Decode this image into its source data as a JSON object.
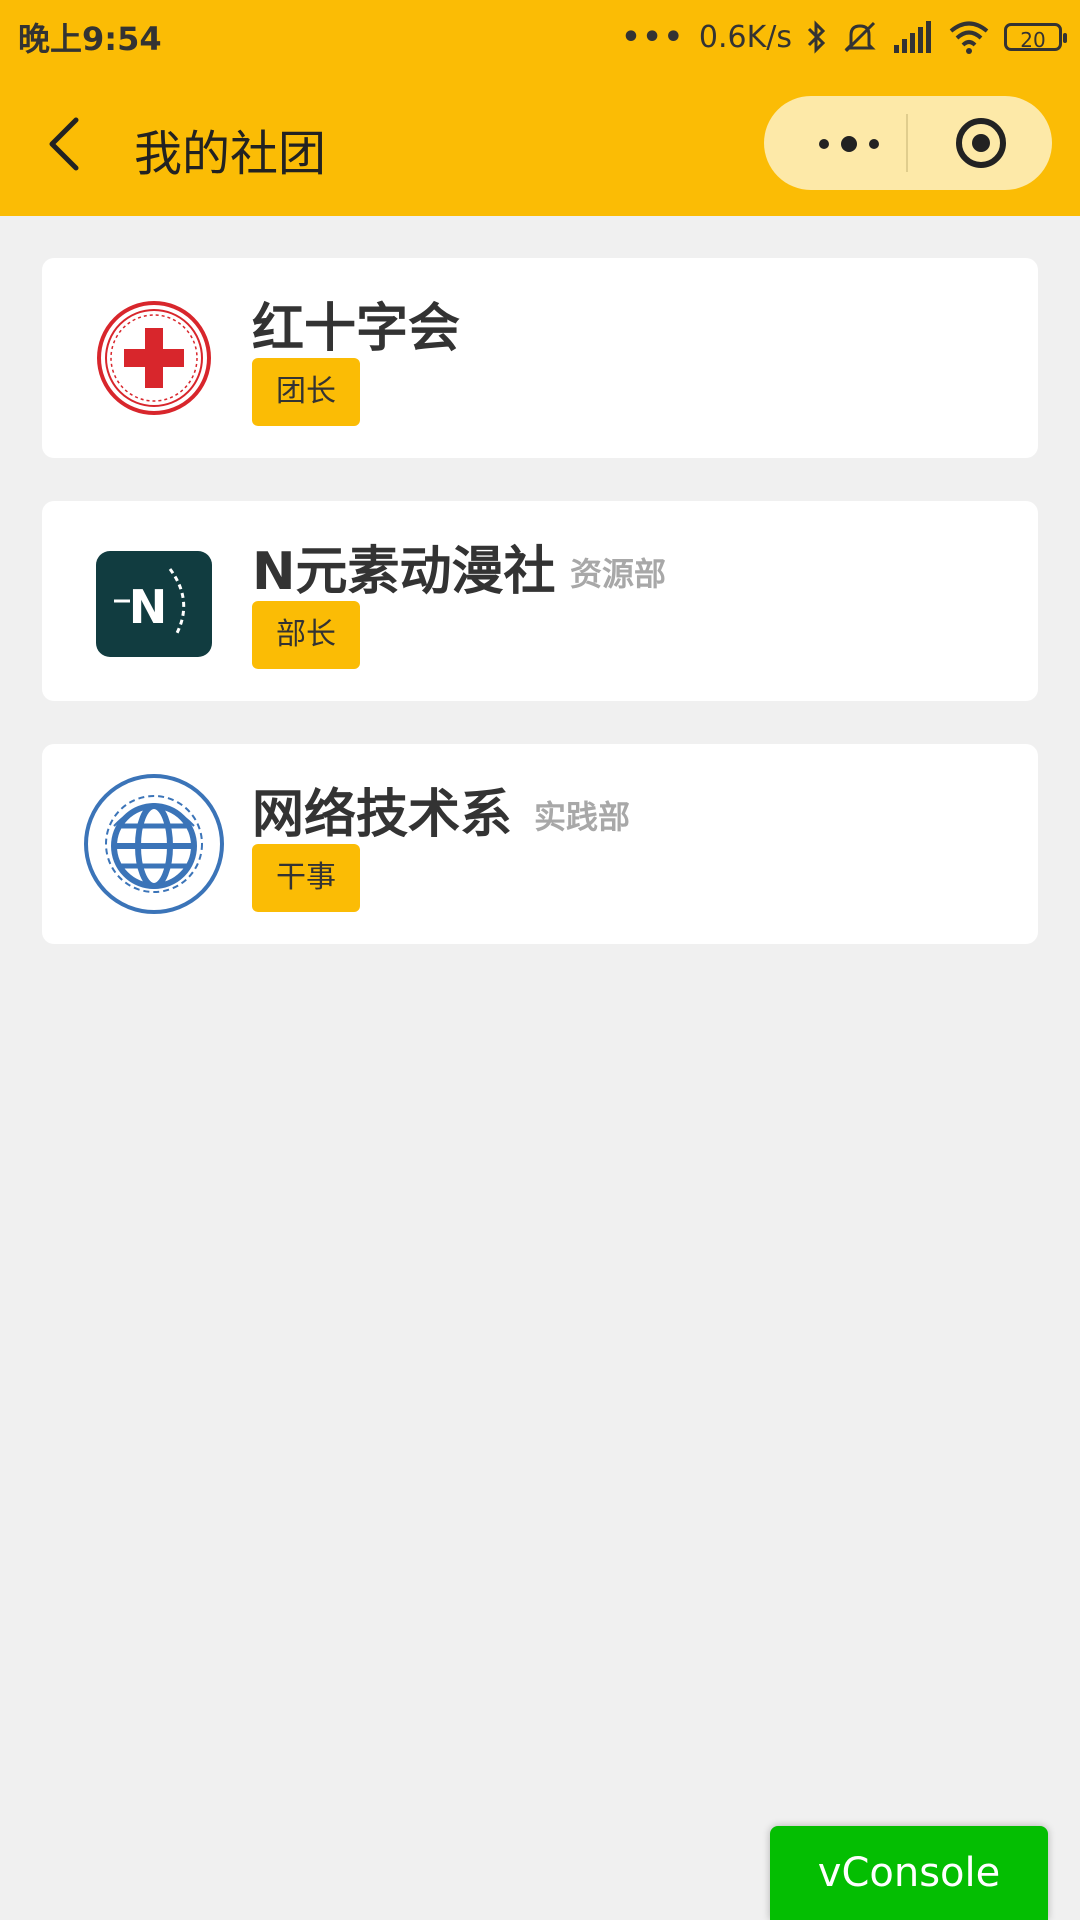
{
  "status_bar": {
    "time": "晚上9:54",
    "signal_dots": "•••",
    "net_speed": "0.6K/s",
    "battery": "20"
  },
  "nav": {
    "title": "我的社团",
    "back_icon": "chevron-left-icon",
    "more_icon": "more-dots-icon",
    "close_icon": "target-close-icon"
  },
  "clubs": [
    {
      "name": "红十字会",
      "dept": "",
      "role": "团长",
      "logo": "red-cross-logo"
    },
    {
      "name": "N元素动漫社",
      "dept": "资源部",
      "role": "部长",
      "logo": "n-element-logo"
    },
    {
      "name": "网络技术系",
      "dept": "实践部",
      "role": "干事",
      "logo": "globe-logo"
    }
  ],
  "vconsole": {
    "label": "vConsole"
  },
  "colors": {
    "accent": "#fbbc05",
    "capsule": "#fde9a8",
    "vconsole": "#04be02",
    "bg": "#f0f0f0"
  }
}
